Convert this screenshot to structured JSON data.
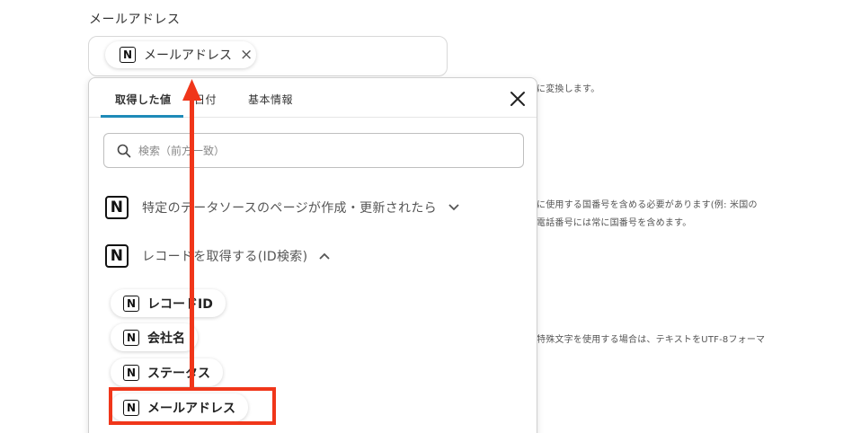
{
  "field": {
    "label": "メールアドレス",
    "selected_chip": "メールアドレス",
    "chip_remove": "×"
  },
  "background_notes": [
    "に変換します。",
    "に使用する国番号を含める必要があります(例: 米国の",
    "電話番号には常に国番号を含めます。",
    "特殊文字を使用する場合は、テキストをUTF-8フォーマ"
  ],
  "popover": {
    "tabs": [
      "取得した値",
      "日付",
      "基本情報"
    ],
    "active_tab": 0,
    "search_placeholder": "検索（前方一致）",
    "sections": [
      {
        "label": "特定のデータソースのページが作成・更新されたら",
        "state": "collapsed",
        "icon": "notion-logo"
      },
      {
        "label": "レコードを取得する(ID検索)",
        "state": "expanded",
        "icon": "notion-logo"
      }
    ],
    "items": [
      "レコードID",
      "会社名",
      "ステータス",
      "メールアドレス"
    ],
    "highlighted_item": "メールアドレス"
  },
  "colors": {
    "accent_tab": "#1e8bb8",
    "annotation_red": "#f0361a"
  }
}
